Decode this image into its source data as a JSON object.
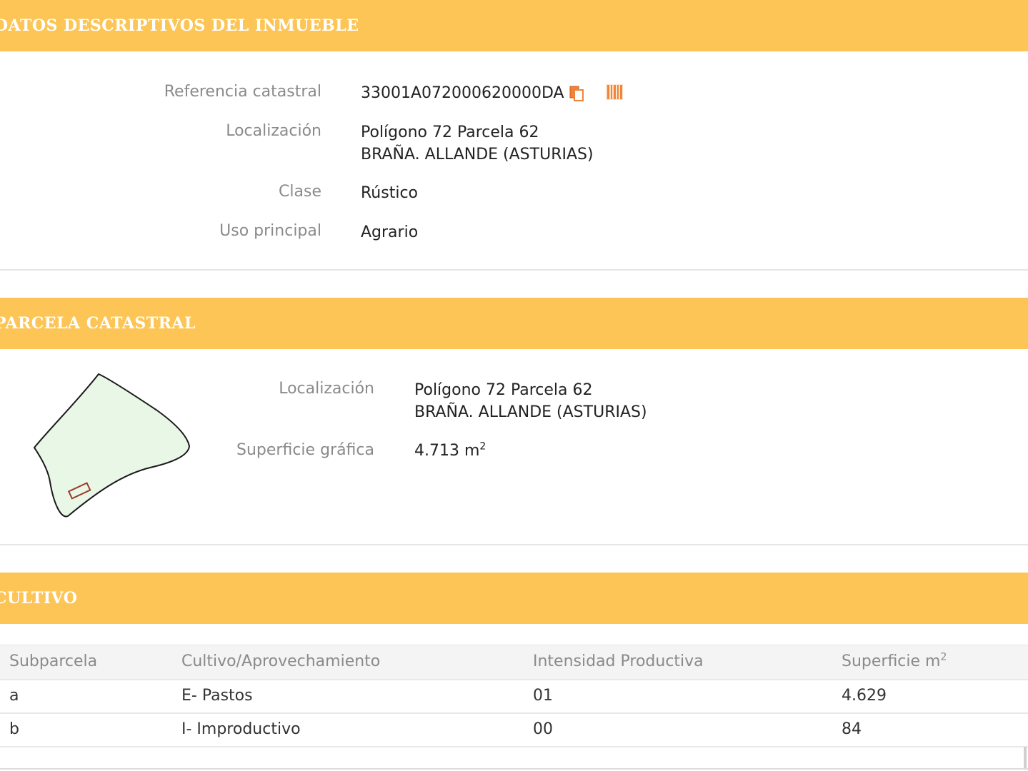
{
  "sections": {
    "datos": {
      "title": "DATOS DESCRIPTIVOS DEL INMUEBLE",
      "referencia_label": "Referencia catastral",
      "referencia_value": "33001A072000620000DA",
      "localizacion_label": "Localización",
      "localizacion_line1": "Polígono 72 Parcela 62",
      "localizacion_line2": "BRAÑA. ALLANDE (ASTURIAS)",
      "clase_label": "Clase",
      "clase_value": "Rústico",
      "uso_label": "Uso principal",
      "uso_value": "Agrario"
    },
    "parcela": {
      "title": "PARCELA CATASTRAL",
      "localizacion_label": "Localización",
      "localizacion_line1": "Polígono 72 Parcela 62",
      "localizacion_line2": "BRAÑA. ALLANDE (ASTURIAS)",
      "superficie_label": "Superficie gráfica",
      "superficie_value": "4.713 m",
      "superficie_sup": "2"
    },
    "cultivo": {
      "title": "CULTIVO",
      "headers": [
        "Subparcela",
        "Cultivo/Aprovechamiento",
        "Intensidad Productiva",
        "Superficie m"
      ],
      "header_sup": "2",
      "rows": [
        [
          "a",
          "E- Pastos",
          "01",
          "4.629"
        ],
        [
          "b",
          "I- Improductivo",
          "00",
          "84"
        ]
      ]
    }
  },
  "icons": {
    "copy": "copy-icon",
    "barcode": "barcode-icon"
  },
  "colors": {
    "band": "#fcc555",
    "parcel_fill": "#e9f7e6",
    "icon_orange": "#f0833a"
  }
}
